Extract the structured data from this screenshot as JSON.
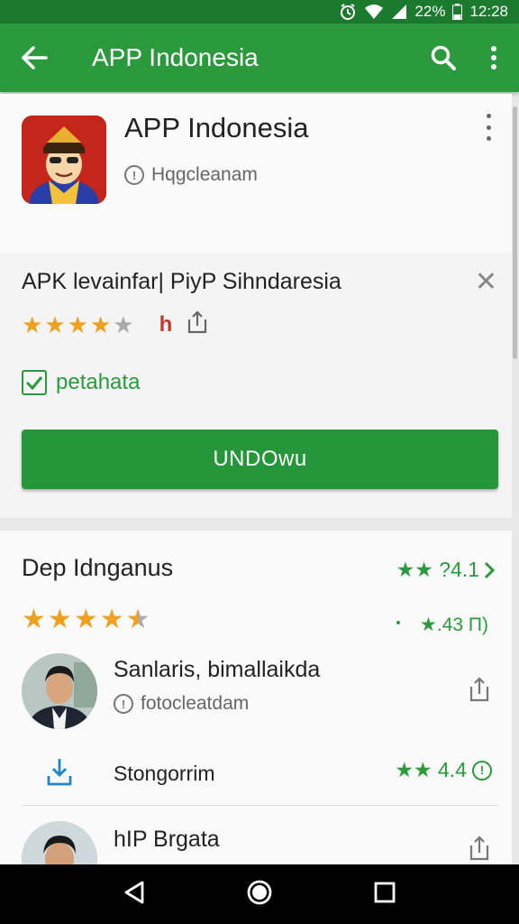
{
  "status_bar": {
    "battery": "22%",
    "time": "12:28"
  },
  "app_bar": {
    "title": "APP Indonesia"
  },
  "app_header": {
    "name": "APP Indonesia",
    "subtitle": "Hqgcleanam"
  },
  "promo": {
    "title": "APK levainfar| PiyP Sihndaresia",
    "stars": 4,
    "badge_letter": "h",
    "checkbox_label": "petahata",
    "install_label": "UNDOwu"
  },
  "reviews_section": {
    "title": "Dep Idnganus",
    "rating": "★★ ?4.1",
    "stars": 4.5,
    "count": "★.43 П)",
    "items": [
      {
        "name": "Sanlaris, bimallaikda",
        "subtitle": "fotocleatdam"
      },
      {
        "label": "Stongorrim",
        "rating": "★★ 4.4"
      },
      {
        "name": "hIP Brgata"
      }
    ]
  },
  "colors": {
    "app_bar": "#2a9a3d",
    "status_bar": "#1b7a2e",
    "accent_star": "#f0a020",
    "button": "#25973a"
  }
}
